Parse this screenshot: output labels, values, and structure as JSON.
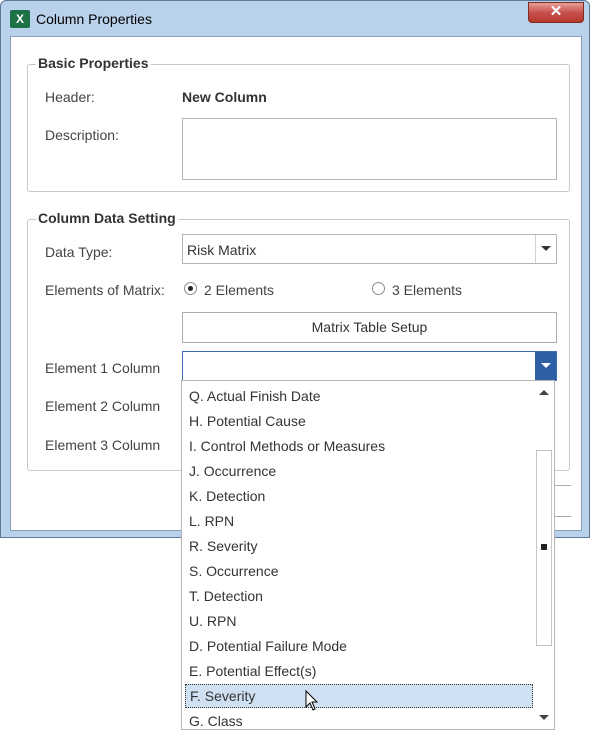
{
  "window": {
    "title": "Column Properties",
    "app_icon": "excel-icon",
    "close_glyph": "✕"
  },
  "basic": {
    "legend": "Basic Properties",
    "header_label": "Header:",
    "header_value": "New Column",
    "description_label": "Description:",
    "description_value": ""
  },
  "data_setting": {
    "legend": "Column Data Setting",
    "data_type_label": "Data Type:",
    "data_type_value": "Risk Matrix",
    "elements_label": "Elements of Matrix:",
    "option_2": "2 Elements",
    "option_3": "3 Elements",
    "selected_option": "2 Elements",
    "matrix_button": "Matrix Table Setup",
    "element1_label": "Element 1 Column",
    "element2_label": "Element 2 Column",
    "element3_label": "Element 3 Column",
    "element1_value": ""
  },
  "dropdown": {
    "items": [
      "Q. Actual Finish Date",
      "H. Potential Cause",
      "I. Control Methods or Measures",
      "J. Occurrence",
      "K. Detection",
      "L. RPN",
      "R. Severity",
      "S. Occurrence",
      "T. Detection",
      "U. RPN",
      "D. Potential Failure Mode",
      "E. Potential Effect(s)",
      "F. Severity",
      "G. Class"
    ],
    "highlighted": "F. Severity"
  }
}
